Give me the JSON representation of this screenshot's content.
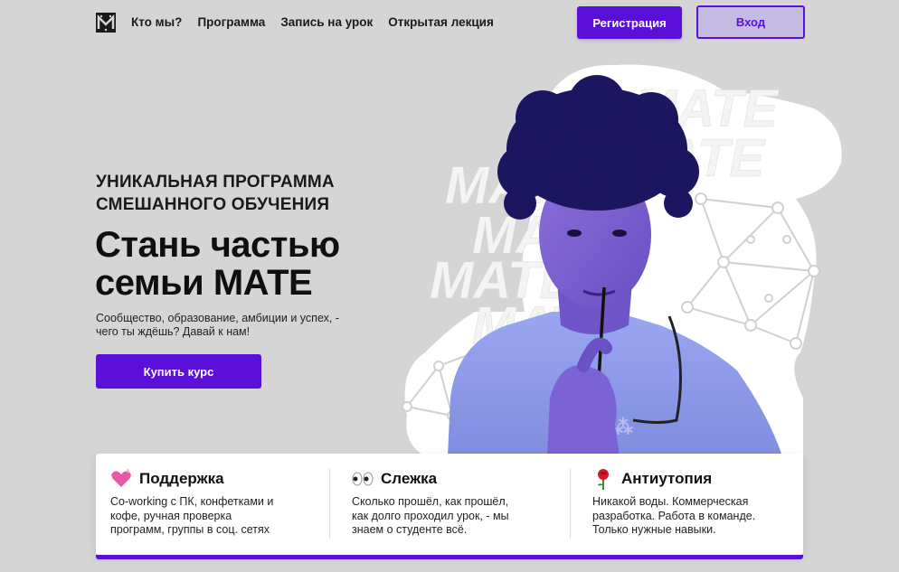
{
  "nav": {
    "links": [
      "Кто мы?",
      "Программа",
      "Запись на урок",
      "Открытая лекция"
    ],
    "register_label": "Регистрация",
    "login_label": "Вход"
  },
  "hero": {
    "eyebrow_line1": "УНИКАЛЬНАЯ ПРОГРАММА",
    "eyebrow_line2": "СМЕШАННОГО ОБУЧЕНИЯ",
    "headline_line1": "Стань частью",
    "headline_line2": "семьи МАТЕ",
    "subtitle_line1": "Сообщество, образование, амбиции и успех, -",
    "subtitle_line2": "чего ты ждёшь? Давай к нам!",
    "buy_label": "Купить курс",
    "brand_word": "MATE"
  },
  "features": [
    {
      "icon": "heart-icon",
      "title": "Поддержка",
      "line1": "Co-working с ПК, конфетками и",
      "line2": "кофе, ручная проверка",
      "line3": "программ, группы в соц. сетях"
    },
    {
      "icon": "eyes-icon",
      "title": "Слежка",
      "line1": "Сколько прошёл, как прошёл,",
      "line2": "как долго проходил урок, - мы",
      "line3": "знаем о студенте всё."
    },
    {
      "icon": "rose-icon",
      "title": "Антиутопия",
      "line1": "Никакой воды. Коммерческая",
      "line2": "разработка. Работа в команде.",
      "line3": "Только нужные навыки."
    }
  ],
  "colors": {
    "accent": "#5b10d8",
    "background": "#d5d5d5",
    "card": "#ffffff"
  }
}
